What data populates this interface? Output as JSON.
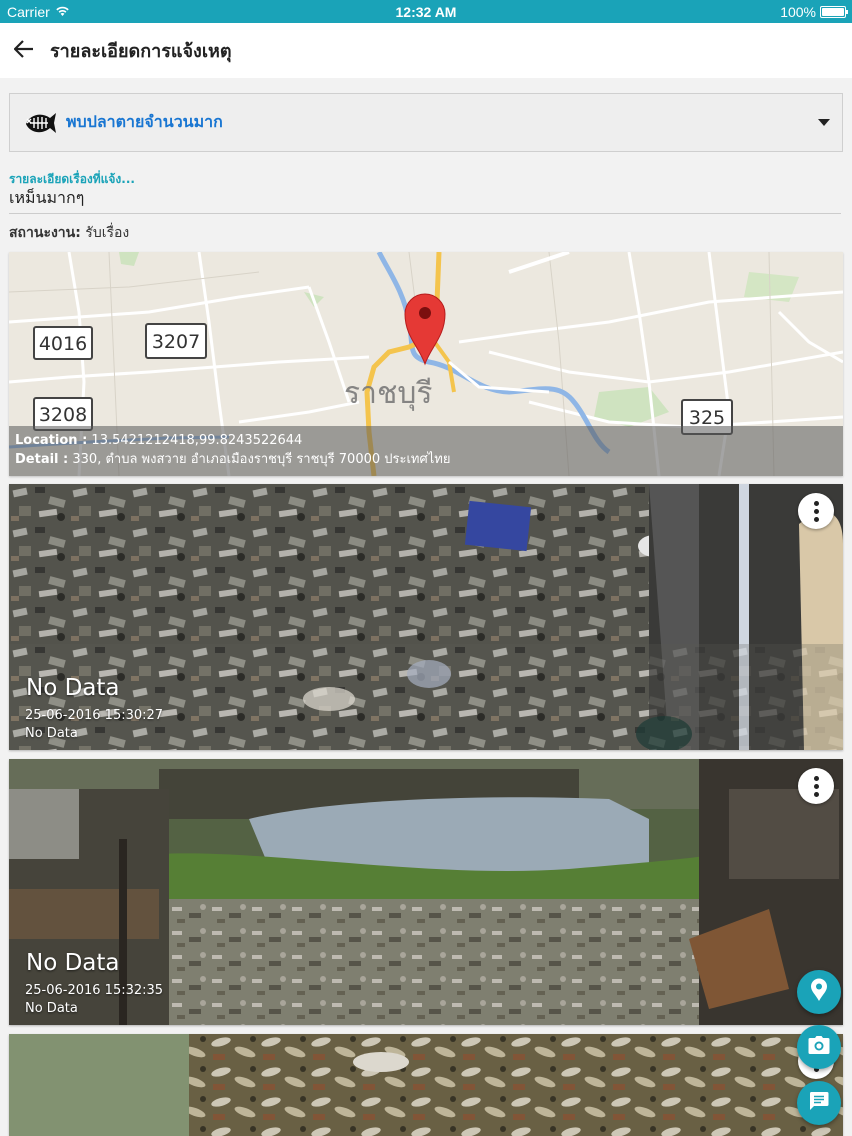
{
  "status_bar": {
    "carrier": "Carrier",
    "time": "12:32 AM",
    "battery": "100%"
  },
  "app_bar": {
    "title": "รายละเอียดการแจ้งเหตุ",
    "back_icon": "arrow-back-icon"
  },
  "category": {
    "label": "พบปลาตายจำนวนมาก",
    "icon": "dead-fish-icon"
  },
  "detail": {
    "label": "รายละเอียดเรื่องที่แจ้ง...",
    "value": "เหม็นมากๆ"
  },
  "status": {
    "label": "สถานะงาน:",
    "value": "รับเรื่อง"
  },
  "map": {
    "location_label": "Location :",
    "location_value": "13.5421212418,99.8243522644",
    "detail_label": "Detail :",
    "detail_value": "330, ตำบล พงสวาย อำเภอเมืองราชบุรี ราชบุรี 70000 ประเทศไทย",
    "city_label": "ราชบุรี",
    "road_shields": [
      "4016",
      "3207",
      "3208",
      "325"
    ]
  },
  "photos": [
    {
      "title": "No Data",
      "date": "25-06-2016 15:30:27",
      "desc": "No Data"
    },
    {
      "title": "No Data",
      "date": "25-06-2016 15:32:35",
      "desc": "No Data"
    },
    {
      "title": "",
      "date": "",
      "desc": ""
    }
  ],
  "fabs": [
    "location-pin-icon",
    "camera-icon",
    "chat-icon"
  ],
  "colors": {
    "accent": "#1aa3b8",
    "category_text": "#1976d2",
    "pin": "#e53935"
  }
}
